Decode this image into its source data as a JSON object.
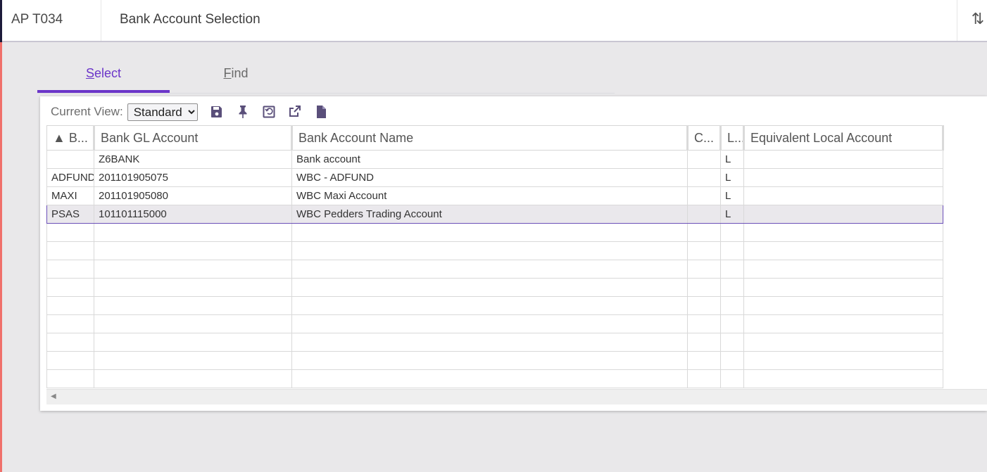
{
  "header": {
    "code": "AP T034",
    "title": "Bank Account Selection",
    "sort_icon": "⇅"
  },
  "tabs": [
    {
      "label_first": "S",
      "label_rest": "elect",
      "active": true
    },
    {
      "label_first": "F",
      "label_rest": "ind",
      "active": false
    }
  ],
  "toolbar": {
    "current_view_label": "Current View:",
    "current_view_value": "Standard",
    "icons": [
      "save-icon",
      "pin-icon",
      "restore-icon",
      "export-icon",
      "document-icon"
    ]
  },
  "grid": {
    "columns": [
      "▲ B...",
      "Bank GL Account",
      "Bank Account Name",
      "C...",
      "L...",
      "Equivalent Local Account"
    ],
    "rows": [
      [
        "",
        "Z6BANK",
        "Bank account",
        "",
        "L",
        ""
      ],
      [
        "ADFUND",
        "201101905075",
        "WBC - ADFUND",
        "",
        "L",
        ""
      ],
      [
        "MAXI",
        "201101905080",
        "WBC Maxi Account",
        "",
        "L",
        ""
      ],
      [
        "PSAS",
        "101101115000",
        "WBC Pedders Trading Account",
        "",
        "L",
        ""
      ]
    ],
    "selected_row": 3
  },
  "colors": {
    "accent": "#6b35c9",
    "left_bar": "#f0706b",
    "selection_border": "#6b4fb8"
  }
}
